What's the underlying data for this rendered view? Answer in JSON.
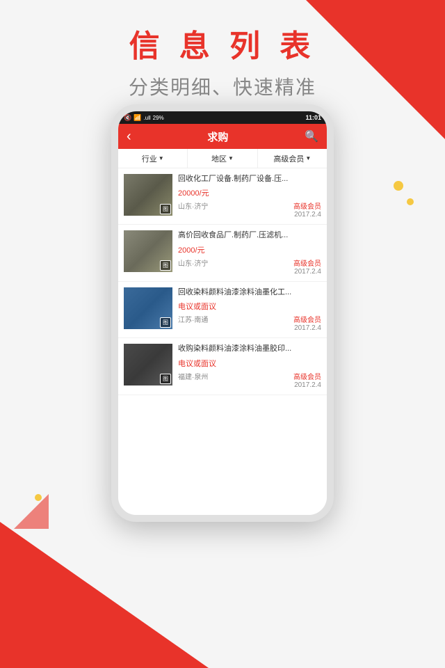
{
  "page": {
    "title": "信 息 列 表",
    "subtitle": "分类明细、快速精准"
  },
  "phone": {
    "status": {
      "battery": "29%",
      "time": "11:01",
      "signal": "📶"
    },
    "header": {
      "back_label": "‹",
      "title": "求购",
      "search_icon": "🔍"
    },
    "filters": [
      {
        "label": "行业",
        "arrow": "▼"
      },
      {
        "label": "地区",
        "arrow": "▼"
      },
      {
        "label": "高级会员",
        "arrow": "▼"
      }
    ],
    "items": [
      {
        "title": "回收化工厂设备.制药厂设备.压...",
        "price": "20000/元",
        "badge": "高级会员",
        "location": "山东·济宁",
        "date": "2017.2.4",
        "img_class": "img-1"
      },
      {
        "title": "高价回收食品厂.制药厂.压滤机...",
        "price": "2000/元",
        "badge": "高级会员",
        "location": "山东·济宁",
        "date": "2017.2.4",
        "img_class": "img-2"
      },
      {
        "title": "回收染料颜料油漆涂料油墨化工...",
        "price": "电议或面议",
        "badge": "高级会员",
        "location": "江苏·南通",
        "date": "2017.2.4",
        "img_class": "img-3"
      },
      {
        "title": "收购染料颜料油漆涂料油墨胶印...",
        "price": "电议或面议",
        "badge": "高级会员",
        "location": "福建·泉州",
        "date": "2017.2.4",
        "img_class": "img-4"
      }
    ],
    "img_label": "图"
  }
}
